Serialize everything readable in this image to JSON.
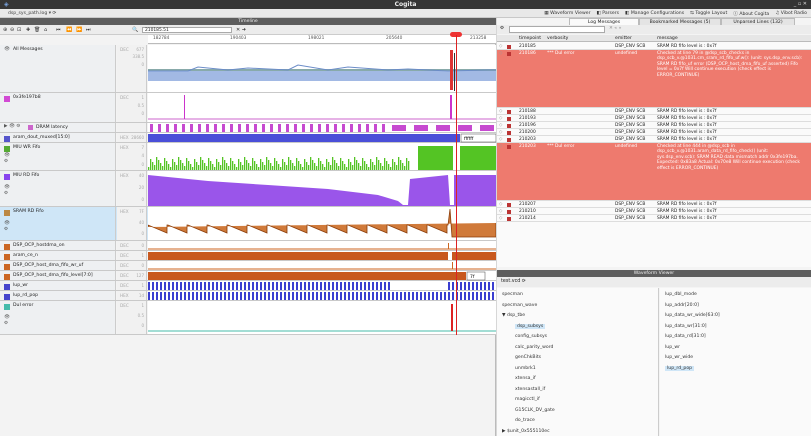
{
  "window": {
    "title": "Cogita",
    "controls": "_ ▫ ✕"
  },
  "menubar": {
    "file": "dsp_sys_path.log ▾  ⟳",
    "items": [
      "▦ Waveform Viewer",
      "◧ Parsers",
      "◧ Manage Configurations",
      "⇆ Toggle Layout",
      "ⓘ About Cogita",
      "♫ Vibot Radio"
    ]
  },
  "timeline": {
    "header": "Timeline",
    "toolbar": [
      "⊕",
      "⊖",
      "⊡",
      "|",
      "✚",
      "🗑",
      "⌂",
      "|",
      "⏮",
      "⏪",
      "⏩",
      "⏭"
    ],
    "time_value": "210185.51",
    "ruler_ticks": [
      "182784",
      "190403",
      "198021",
      "205640",
      "213258"
    ],
    "rows": [
      {
        "name": "All Messages",
        "fmt": "DEC",
        "vals": [
          "677",
          "338.5",
          "0"
        ],
        "color": "#8ab"
      },
      {
        "name": "0x3fe197b8",
        "fmt": "DEC",
        "vals": [
          "1",
          "0.5",
          "0"
        ],
        "color": "#d4c"
      },
      {
        "name": "DRAM latency",
        "fmt": "",
        "vals": [],
        "color": "#c6c"
      },
      {
        "name": "aram_dout_muxed[15:0]",
        "fmt": "HEX",
        "vals": [
          "28660"
        ],
        "color": "#55c"
      },
      {
        "name": "MIU WR Fifo",
        "fmt": "HEX",
        "vals": [
          "7",
          "4",
          "0"
        ],
        "color": "#5a3"
      },
      {
        "name": "MIU RD Fifo",
        "fmt": "HEX",
        "vals": [
          "40",
          "20",
          "0"
        ],
        "color": "#84e"
      },
      {
        "name": "SRAM RD Fifo",
        "fmt": "HEX",
        "vals": [
          "7F",
          "40",
          "0"
        ],
        "color": "#b84"
      },
      {
        "name": "DSP_OCP_hostdma_on",
        "fmt": "DEC",
        "vals": [
          "0"
        ],
        "color": "#c62"
      },
      {
        "name": "aram_ce_n",
        "fmt": "DEC",
        "vals": [
          "1"
        ],
        "color": "#c62"
      },
      {
        "name": "DSP_OCP_host_dma_fifo_wr_uf",
        "fmt": "DEC",
        "vals": [
          "0"
        ],
        "color": "#c62"
      },
      {
        "name": "DSP_OCP_host_dma_fifo_level[7:0]",
        "fmt": "DEC",
        "vals": [
          "127"
        ],
        "color": "#c62"
      },
      {
        "name": "lup_wr",
        "fmt": "DEC",
        "vals": [
          "1"
        ],
        "color": "#44c"
      },
      {
        "name": "lup_rd_pop",
        "fmt": "HEX",
        "vals": [
          "1d"
        ],
        "color": "#44c"
      },
      {
        "name": "DuI error",
        "fmt": "DEC",
        "vals": [
          "1",
          "0.5",
          "0"
        ],
        "color": "#4ba"
      }
    ],
    "badges": {
      "aram": "ffffff",
      "fifo": "7f"
    }
  },
  "right": {
    "tabs": [
      "Log Messages",
      "Bookmarked Messages (5)",
      "Unparsed Lines (132)"
    ],
    "filter_placeholder": "",
    "columns": [
      "timepoint",
      "verbosity",
      "emitter",
      "message"
    ],
    "rows": [
      {
        "t": "210185",
        "v": "",
        "e": "DSP_ENV SCB",
        "m": "SRAM RD fifo level is : 0x7f",
        "err": false
      },
      {
        "t": "210186",
        "v": "*** DuI error",
        "e": "undefined",
        "m": "Checked at line 79 in @dsp_scb_checks in dsp_scb_v.@1031.cm_sram_rd_fifo_uf.w(): (unit: sys.dsp_env.scb): SRAM RD fifo_uf error (DSP_OCP_host_dma_fifo_uf asserted) Fifo level = 0x7f Will continue execution (check effect is ERROR_CONTINUE)",
        "err": true
      },
      {
        "t": "210188",
        "v": "",
        "e": "DSP_ENV SCB",
        "m": "SRAM RD fifo level is : 0x7f",
        "err": false
      },
      {
        "t": "210193",
        "v": "",
        "e": "DSP_ENV SCB",
        "m": "SRAM RD fifo level is : 0x7f",
        "err": false
      },
      {
        "t": "210196",
        "v": "",
        "e": "DSP_ENV SCB",
        "m": "SRAM RD fifo level is : 0x7f",
        "err": false
      },
      {
        "t": "210200",
        "v": "",
        "e": "DSP_ENV SCB",
        "m": "SRAM RD fifo level is : 0x7f",
        "err": false
      },
      {
        "t": "210203",
        "v": "",
        "e": "DSP_ENV SCB",
        "m": "SRAM RD fifo level is : 0x7f",
        "err": false
      },
      {
        "t": "210203",
        "v": "*** DuI error",
        "e": "undefined",
        "m": "Checked at line 444 in @dsp_scb in dsp_scb_v.@1031.aram_data_rd_fifo_check() (unit: sys.dsp_env.scb): SRAM READ data mismatch addr 0x3fe197ba. Expected: 0x83a8 Actual: 0x70e8 Will continue execution (check effect is ERROR_CONTINUE)",
        "err": true
      },
      {
        "t": "210207",
        "v": "",
        "e": "DSP_ENV SCB",
        "m": "SRAM RD fifo level is : 0x7f",
        "err": false
      },
      {
        "t": "210210",
        "v": "",
        "e": "DSP_ENV SCB",
        "m": "SRAM RD fifo level is : 0x7f",
        "err": false
      },
      {
        "t": "210214",
        "v": "",
        "e": "DSP_ENV SCB",
        "m": "SRAM RD fifo level is : 0x7f",
        "err": false
      }
    ],
    "waveform_viewer": {
      "header": "Waveform Viewer",
      "file": "test.vcd  ⟳",
      "tree": [
        "specman",
        "specman_wave",
        "▼ dsp_tbe",
        "dsp_subsys",
        "config_subsys",
        "calc_parity_word",
        "genChkBits",
        "unmbrk1",
        "xtensa_if",
        "xtensastall_if",
        "magicctl_if",
        "G15CLK_DV_gate",
        "do_trace",
        "▶ $unit_0x555110ec"
      ],
      "signals": [
        "lup_dbl_mode",
        "lup_addr[20:0]",
        "lup_data_wr_wide[63:0]",
        "lup_data_wr[31:0]",
        "lup_data_rd[31:0]",
        "lup_wr",
        "lup_wr_wide",
        "lup_rd_pop"
      ]
    }
  }
}
